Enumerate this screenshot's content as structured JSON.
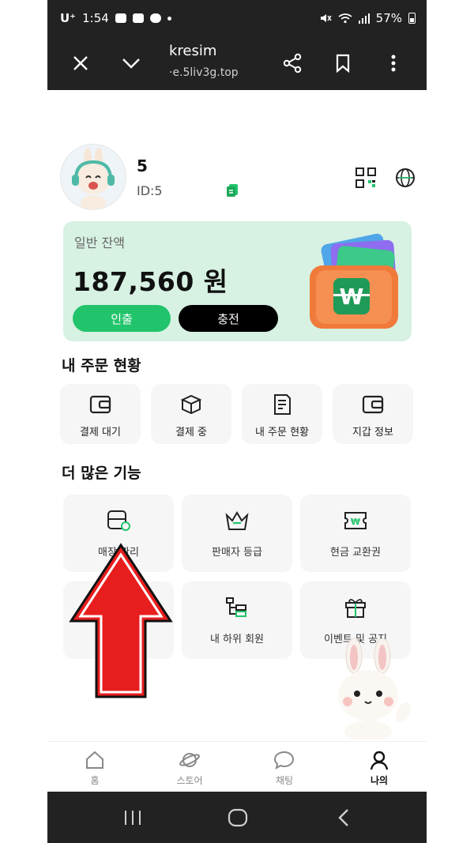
{
  "status_bar": {
    "carrier": "U⁺",
    "time": "1:54",
    "battery": "57%"
  },
  "browser": {
    "title": "kresim",
    "url": "·e.5liv3g.top"
  },
  "profile": {
    "name": "5",
    "id": "ID:5"
  },
  "balance": {
    "label": "일반 잔액",
    "amount": "187,560 원",
    "withdraw_label": "인출",
    "charge_label": "충전"
  },
  "orders": {
    "title": "내 주문 현황",
    "items": [
      {
        "label": "결제 대기",
        "icon": "wallet-icon"
      },
      {
        "label": "결제 중",
        "icon": "box-icon"
      },
      {
        "label": "내 주문 현황",
        "icon": "document-icon"
      },
      {
        "label": "지갑 정보",
        "icon": "wallet-icon"
      }
    ]
  },
  "features": {
    "title": "더 많은 기능",
    "items": [
      {
        "label": "매장 관리",
        "icon": "store-settings-icon"
      },
      {
        "label": "판매자 등급",
        "icon": "crown-icon"
      },
      {
        "label": "현금 교환권",
        "icon": "ticket-icon"
      },
      {
        "label": "",
        "icon": "hidden-item"
      },
      {
        "label": "내 하위 회원",
        "icon": "hierarchy-icon"
      },
      {
        "label": "이벤트 및 공지",
        "icon": "gift-icon"
      }
    ]
  },
  "bottom_nav": [
    {
      "label": "홈",
      "icon": "home-icon"
    },
    {
      "label": "스토어",
      "icon": "planet-icon"
    },
    {
      "label": "채팅",
      "icon": "chat-icon"
    },
    {
      "label": "나의",
      "icon": "user-icon"
    }
  ],
  "colors": {
    "accent_green": "#22c46b",
    "card_bg": "#d7f1e3",
    "bar_dark": "#222222",
    "arrow_red": "#e81e1e"
  }
}
